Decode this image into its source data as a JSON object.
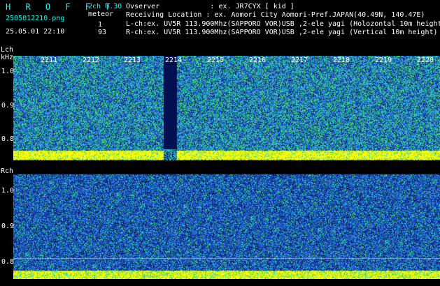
{
  "header": {
    "app_title": "H R O F F T",
    "filename": "2505012210.png",
    "datetime": "25.05.01 22:10",
    "version": "2ch 0.30",
    "mode_label": "meteor",
    "count_l": "1",
    "count_r": "93",
    "observer_line": "Ovserver            : ex. JR7CYX [ kid ]",
    "location_line": "Receiving Location : ex. Aomori City Aomori-Pref.JAPAN(40.49N, 140.47E)",
    "lch_line": "L-ch:ex. UV5R 113.900Mhz(SAPPORO VOR)USB ,2-ele yagi (Holozontal 10m height",
    "rch_line": "R-ch:ex. UV5R 113.900Mhz(SAPPORO VOR)USB ,2-ele yagi (Vertical 10m height)"
  },
  "lch": {
    "label": "Lch",
    "unit": "kHz",
    "y_ticks": [
      "1.0",
      "0.9",
      "0.8"
    ],
    "time_ticks": [
      "2211",
      "2212",
      "2213",
      "2214",
      "2215",
      "2216",
      "2217",
      "2218",
      "2219",
      "2220"
    ]
  },
  "rch": {
    "label": "Rch",
    "y_ticks": [
      "1.0",
      "0.9",
      "0.8"
    ]
  },
  "colors": {
    "background": "#000000",
    "noise_dark": "#0a1e6e",
    "noise_blue": "#1e5adc",
    "noise_cyan": "#28c8c8",
    "noise_green": "#50dc50",
    "signal_yellow": "#ffff00",
    "gap_navy": "#001050"
  }
}
